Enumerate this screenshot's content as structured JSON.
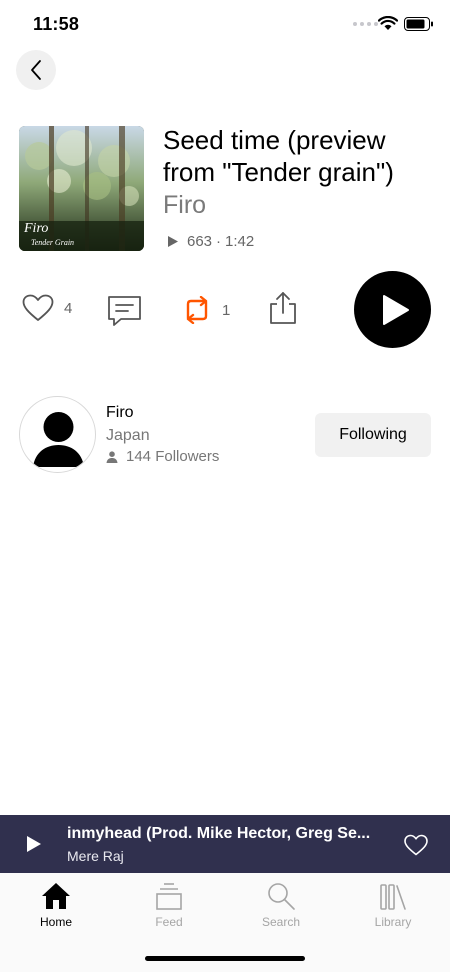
{
  "status_bar": {
    "time": "11:58"
  },
  "track": {
    "title": "Seed time (preview from \"Tender grain\")",
    "artist": "Firo",
    "plays": "663",
    "separator": "·",
    "duration": "1:42",
    "artwork": {
      "title": "Firo",
      "subtitle": "Tender Grain"
    }
  },
  "actions": {
    "likes": "4",
    "reposts": "1",
    "accent_color": "#ff5500"
  },
  "artist_card": {
    "name": "Firo",
    "location": "Japan",
    "followers": "144 Followers",
    "follow_label": "Following"
  },
  "mini_player": {
    "title": "inmyhead (Prod. Mike Hector, Greg Se...",
    "artist": "Mere Raj",
    "background": "#30304e"
  },
  "tabs": [
    {
      "label": "Home",
      "icon": "home-icon",
      "active": true
    },
    {
      "label": "Feed",
      "icon": "feed-icon",
      "active": false
    },
    {
      "label": "Search",
      "icon": "search-icon",
      "active": false
    },
    {
      "label": "Library",
      "icon": "library-icon",
      "active": false
    }
  ]
}
